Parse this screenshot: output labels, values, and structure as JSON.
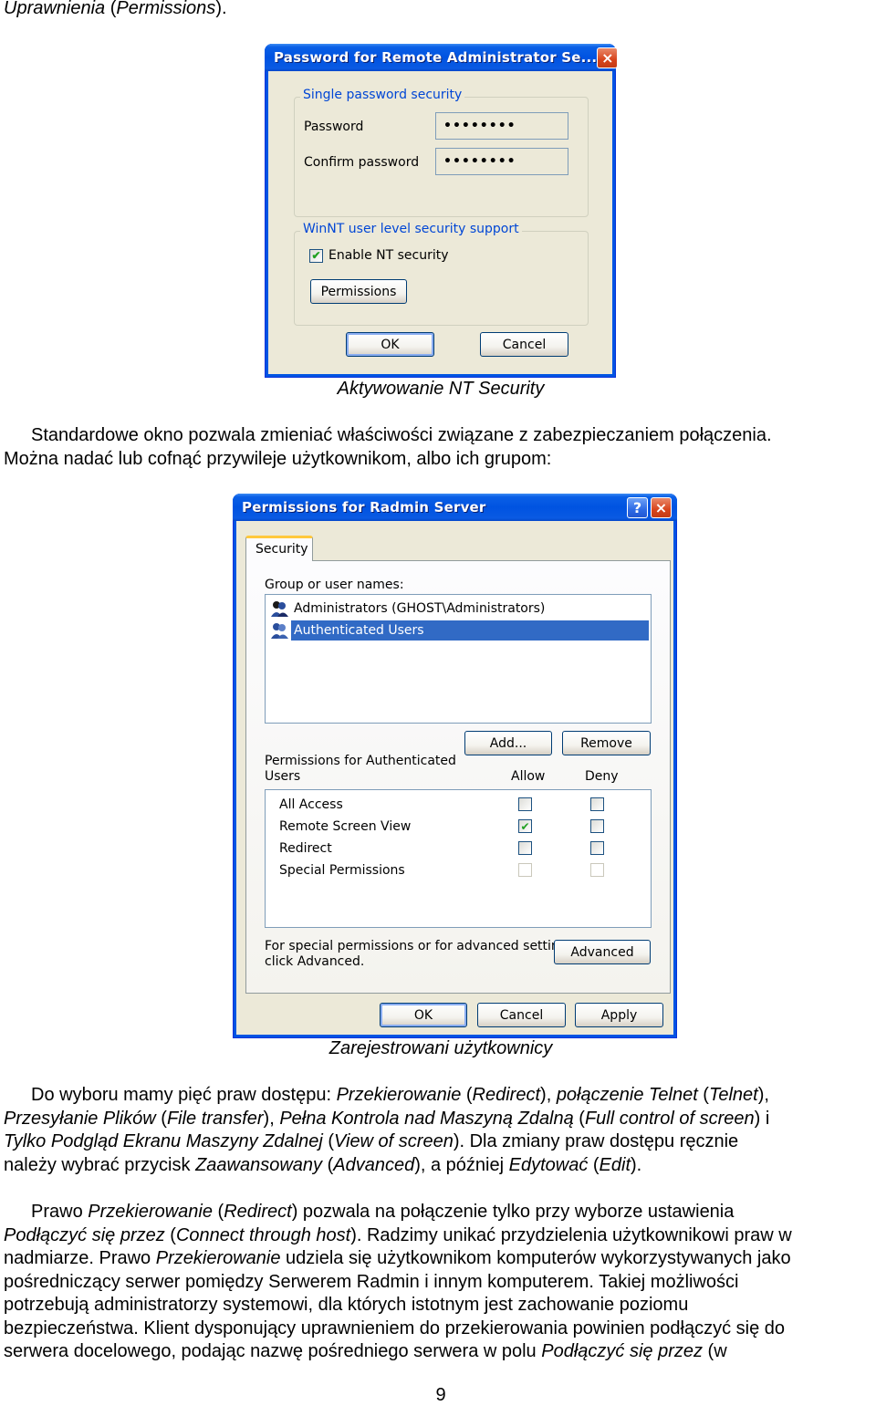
{
  "top_text": {
    "italic_a": "Uprawnienia",
    "plain_a": " (",
    "italic_b": "Permissions",
    "plain_b": ")."
  },
  "dialog1": {
    "title": "Password for Remote Administrator Se...",
    "group_single": "Single password security",
    "password_label": "Password",
    "password_value": "••••••••",
    "confirm_label": "Confirm password",
    "confirm_value": "••••••••",
    "group_nt": "WinNT user level security support",
    "enable_nt_label": "Enable NT security",
    "enable_nt_checked": true,
    "permissions_button": "Permissions",
    "ok_button": "OK",
    "cancel_button": "Cancel",
    "close_icon": "×"
  },
  "caption1": "Aktywowanie NT Security",
  "para1": {
    "line1": "Standardowe okno pozwala zmieniać właściwości związane z zabezpieczaniem połączenia.",
    "line2": "Można nadać lub cofnąć przywileje użytkownikom, albo ich grupom:"
  },
  "dialog2": {
    "title": "Permissions for Radmin Server",
    "help_icon": "?",
    "close_icon": "×",
    "tab_security": "Security",
    "group_label": "Group or user names:",
    "users": [
      {
        "name": "Administrators (GHOST\\Administrators)",
        "selected": false
      },
      {
        "name": "Authenticated Users",
        "selected": true
      }
    ],
    "add_button": "Add...",
    "remove_button": "Remove",
    "perm_label_line1": "Permissions for Authenticated",
    "perm_label_line2": "Users",
    "allow_header": "Allow",
    "deny_header": "Deny",
    "permissions": [
      {
        "name": "All Access",
        "allow": false,
        "deny": false,
        "disabled": false
      },
      {
        "name": "Remote Screen View",
        "allow": true,
        "deny": false,
        "disabled": false
      },
      {
        "name": "Redirect",
        "allow": false,
        "deny": false,
        "disabled": false
      },
      {
        "name": "Special Permissions",
        "allow": false,
        "deny": false,
        "disabled": true
      }
    ],
    "advanced_text_line1": "For special permissions or for advanced settings,",
    "advanced_text_line2": "click Advanced.",
    "advanced_button": "Advanced",
    "ok_button": "OK",
    "cancel_button": "Cancel",
    "apply_button": "Apply"
  },
  "caption2": "Zarejestrowani użytkownicy",
  "para2": [
    [
      {
        "t": "Do wyboru mamy pięć praw dostępu: "
      },
      {
        "i": "Przekierowanie"
      },
      {
        "t": " ("
      },
      {
        "i": "Redirect"
      },
      {
        "t": "), "
      },
      {
        "i": "połączenie Telnet"
      },
      {
        "t": " ("
      },
      {
        "i": "Telnet"
      },
      {
        "t": "),"
      }
    ],
    [
      {
        "i": "Przesyłanie Plików"
      },
      {
        "t": " ("
      },
      {
        "i": "File transfer"
      },
      {
        "t": "), "
      },
      {
        "i": "Pełna Kontrola nad Maszyną Zdalną"
      },
      {
        "t": " ("
      },
      {
        "i": "Full control of screen"
      },
      {
        "t": ") i"
      }
    ],
    [
      {
        "i": "Tylko Podgląd Ekranu Maszyny Zdalnej"
      },
      {
        "t": " ("
      },
      {
        "i": "View of screen"
      },
      {
        "t": "). Dla zmiany praw dostępu ręcznie"
      }
    ],
    [
      {
        "t": "należy wybrać przycisk "
      },
      {
        "i": "Zaawansowany"
      },
      {
        "t": " ("
      },
      {
        "i": "Advanced"
      },
      {
        "t": "), a później "
      },
      {
        "i": "Edytować"
      },
      {
        "t": " ("
      },
      {
        "i": "Edit"
      },
      {
        "t": ")."
      }
    ]
  ],
  "para3": [
    [
      {
        "t": "Prawo "
      },
      {
        "i": "Przekierowanie"
      },
      {
        "t": " ("
      },
      {
        "i": "Redirect"
      },
      {
        "t": ") pozwala na połączenie tylko przy wyborze ustawienia"
      }
    ],
    [
      {
        "i": "Podłączyć się przez"
      },
      {
        "t": " ("
      },
      {
        "i": "Connect through host"
      },
      {
        "t": "). Radzimy unikać przydzielenia użytkownikowi praw w"
      }
    ],
    [
      {
        "t": "nadmiarze. Prawo "
      },
      {
        "i": "Przekierowanie"
      },
      {
        "t": " udziela się użytkownikom komputerów wykorzystywanych jako"
      }
    ],
    [
      {
        "t": "pośredniczący serwer pomiędzy Serwerem Radmin i innym komputerem. Takiej możliwości"
      }
    ],
    [
      {
        "t": "potrzebują administratorzy systemowi, dla których istotnym jest zachowanie poziomu"
      }
    ],
    [
      {
        "t": "bezpieczeństwa. Klient dysponujący uprawnieniem do przekierowania powinien podłączyć się do"
      }
    ],
    [
      {
        "t": "serwera docelowego, podając nazwę pośredniego serwera w polu "
      },
      {
        "i": "Podłączyć się przez"
      },
      {
        "t": " (w"
      }
    ]
  ],
  "page_number": "9"
}
